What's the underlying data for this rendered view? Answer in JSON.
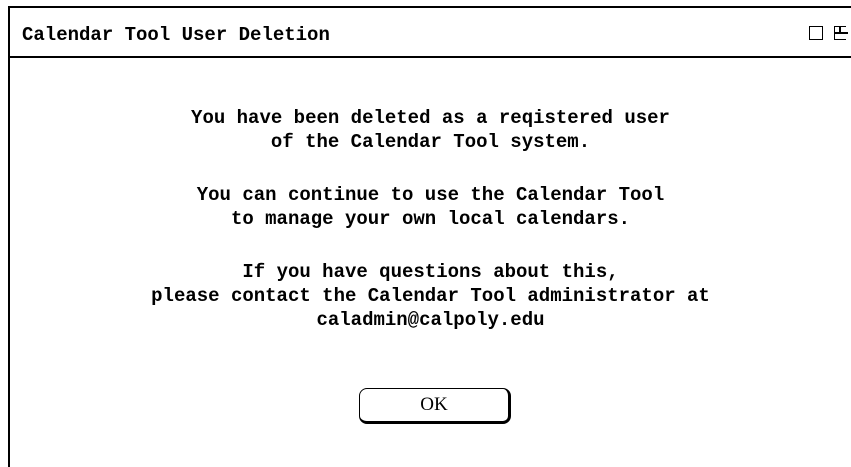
{
  "window": {
    "title": "Calendar Tool User Deletion"
  },
  "message": {
    "paragraph1": [
      "You have been deleted as a reqistered user",
      "of the Calendar Tool system."
    ],
    "paragraph2": [
      "You can continue to use the Calendar Tool",
      "to manage your own local calendars."
    ],
    "paragraph3": [
      "If you have questions about this,",
      "please contact the Calendar Tool administrator at",
      "caladmin@calpoly.edu"
    ]
  },
  "buttons": {
    "ok_label": "OK"
  },
  "icons": {
    "minimize": "minimize-icon",
    "maximize": "maximize-icon"
  }
}
